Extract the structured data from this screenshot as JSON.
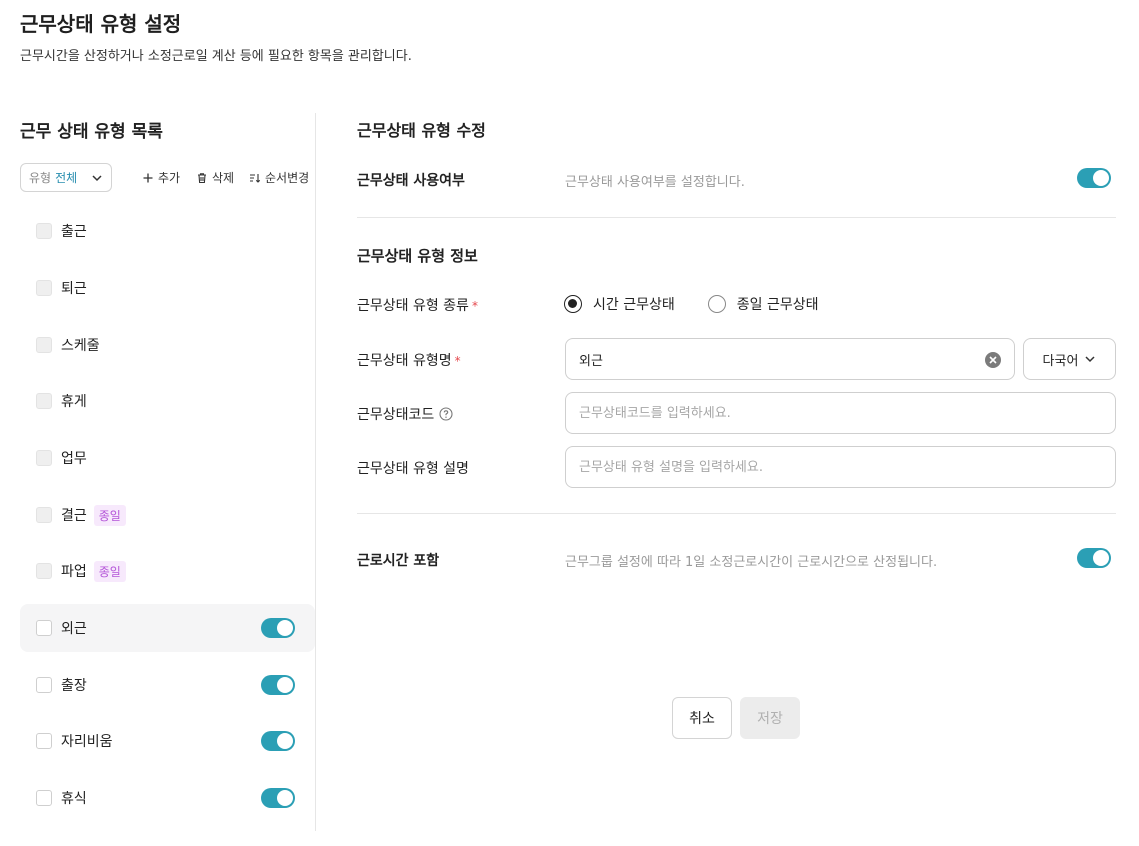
{
  "header": {
    "title": "근무상태 유형 설정",
    "description": "근무시간을 산정하거나 소정근로일 계산 등에 필요한 항목을 관리합니다."
  },
  "left": {
    "title": "근무 상태 유형 목록",
    "filter": {
      "label": "유형",
      "value": "전체"
    },
    "toolbar": {
      "add": "추가",
      "delete": "삭제",
      "reorder": "순서변경"
    },
    "items": [
      {
        "name": "출근",
        "badge": "",
        "toggle_on": false,
        "checkbox_disabled": true
      },
      {
        "name": "퇴근",
        "badge": "",
        "toggle_on": false,
        "checkbox_disabled": true
      },
      {
        "name": "스케줄",
        "badge": "",
        "toggle_on": false,
        "checkbox_disabled": true
      },
      {
        "name": "휴게",
        "badge": "",
        "toggle_on": false,
        "checkbox_disabled": true
      },
      {
        "name": "업무",
        "badge": "",
        "toggle_on": false,
        "checkbox_disabled": true
      },
      {
        "name": "결근",
        "badge": "종일",
        "toggle_on": false,
        "checkbox_disabled": true
      },
      {
        "name": "파업",
        "badge": "종일",
        "toggle_on": false,
        "checkbox_disabled": true
      },
      {
        "name": "외근",
        "badge": "",
        "toggle_on": true,
        "checkbox_disabled": false,
        "selected": true
      },
      {
        "name": "출장",
        "badge": "",
        "toggle_on": true,
        "checkbox_disabled": false
      },
      {
        "name": "자리비움",
        "badge": "",
        "toggle_on": true,
        "checkbox_disabled": false
      },
      {
        "name": "휴식",
        "badge": "",
        "toggle_on": true,
        "checkbox_disabled": false
      }
    ]
  },
  "right": {
    "title": "근무상태 유형 수정",
    "usage": {
      "label": "근무상태 사용여부",
      "help": "근무상태 사용여부를 설정합니다.",
      "on": true
    },
    "info_title": "근무상태 유형 정보",
    "type": {
      "label": "근무상태 유형 종류",
      "options": [
        "시간 근무상태",
        "종일 근무상태"
      ],
      "selected": "시간 근무상태"
    },
    "name": {
      "label": "근무상태 유형명",
      "value": "외근"
    },
    "language": {
      "value": "다국어"
    },
    "code": {
      "label": "근무상태코드",
      "placeholder": "근무상태코드를 입력하세요."
    },
    "desc": {
      "label": "근무상태 유형 설명",
      "placeholder": "근무상태 유형 설명을 입력하세요."
    },
    "work_time": {
      "label": "근로시간 포함",
      "help": "근무그룹 설정에 따라 1일 소정근로시간이 근로시간으로 산정됩니다.",
      "on": true
    }
  },
  "footer": {
    "cancel": "취소",
    "save": "저장"
  },
  "colors": {
    "accent": "#2b9fb5",
    "badge": "#b455d8",
    "required": "#e5484d"
  }
}
